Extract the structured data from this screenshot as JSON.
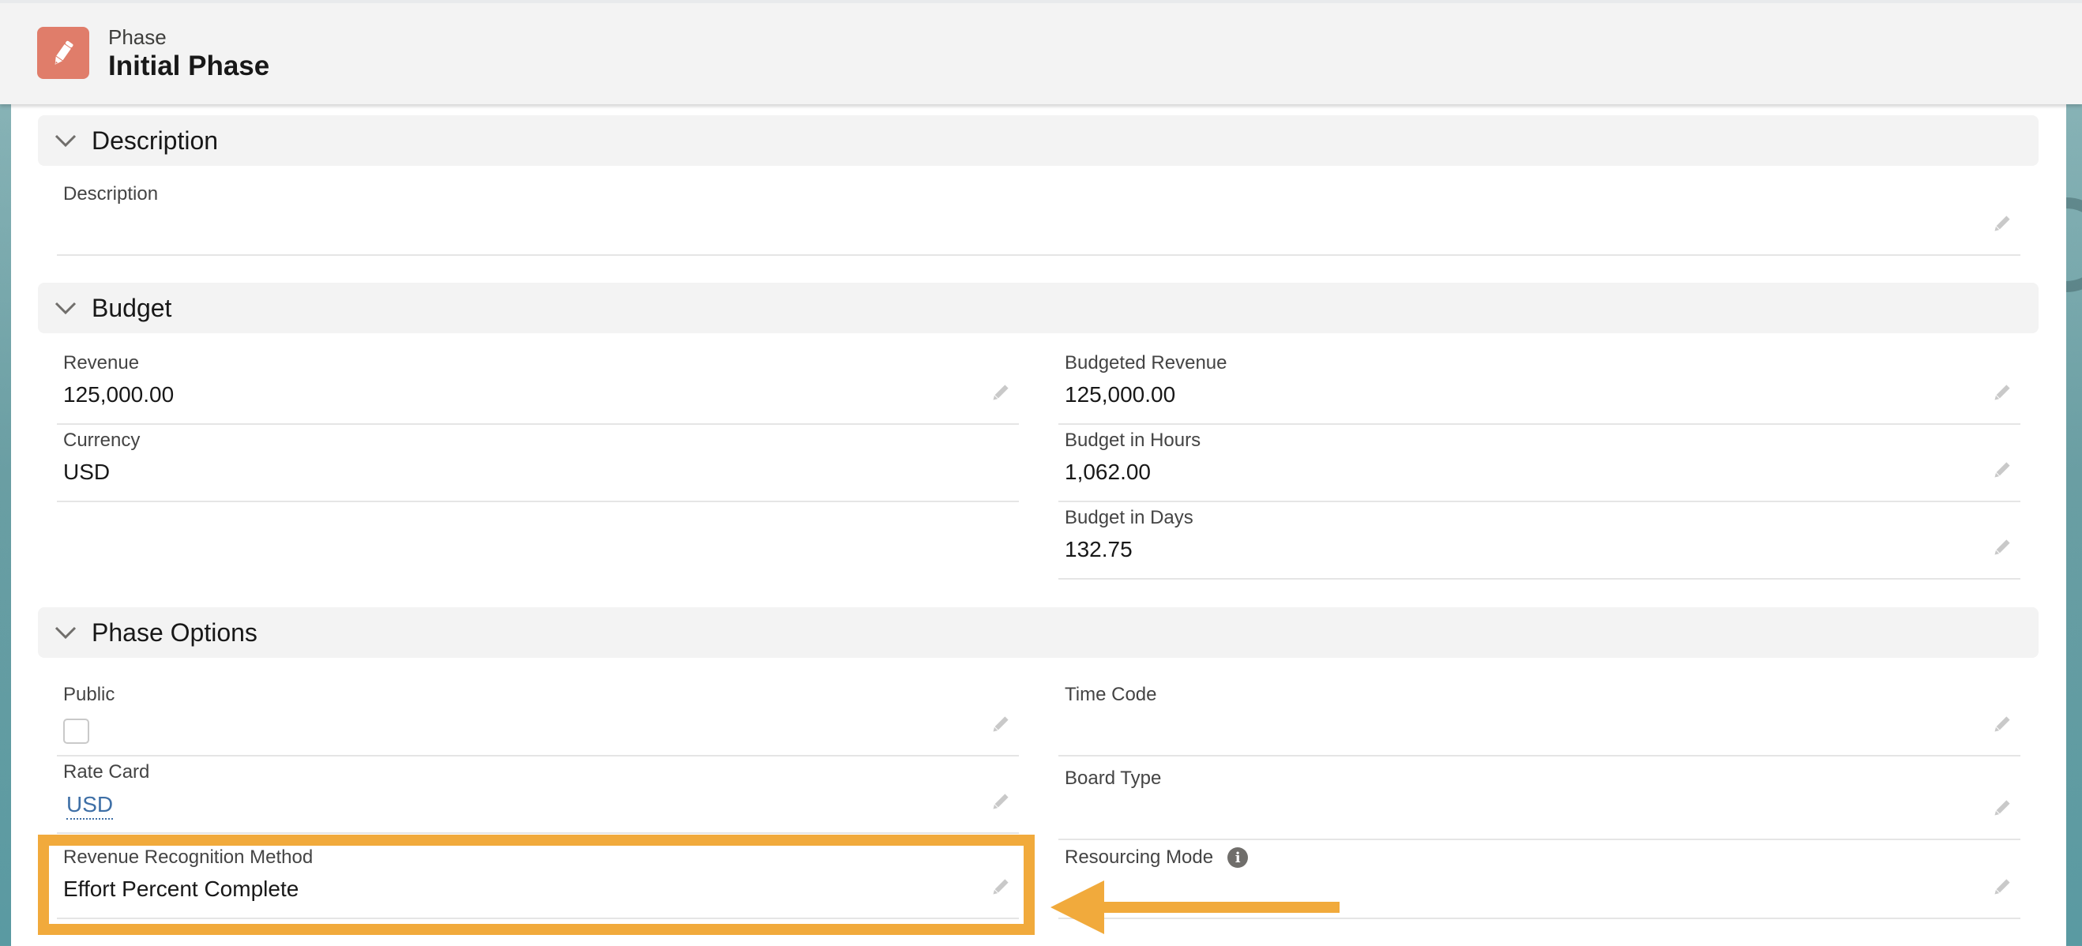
{
  "header": {
    "object_label": "Phase",
    "record_title": "Initial Phase",
    "icon": "pencil-icon",
    "icon_color": "#e07d6a"
  },
  "sections": {
    "description": {
      "title": "Description",
      "fields": {
        "description": {
          "label": "Description",
          "value": ""
        }
      }
    },
    "budget": {
      "title": "Budget",
      "fields": {
        "revenue": {
          "label": "Revenue",
          "value": "125,000.00"
        },
        "currency": {
          "label": "Currency",
          "value": "USD"
        },
        "budgeted_revenue": {
          "label": "Budgeted Revenue",
          "value": "125,000.00"
        },
        "budget_in_hours": {
          "label": "Budget in Hours",
          "value": "1,062.00"
        },
        "budget_in_days": {
          "label": "Budget in Days",
          "value": "132.75"
        }
      }
    },
    "phase_options": {
      "title": "Phase Options",
      "fields": {
        "public": {
          "label": "Public",
          "checked": false
        },
        "time_code": {
          "label": "Time Code",
          "value": ""
        },
        "rate_card": {
          "label": "Rate Card",
          "value": "USD"
        },
        "board_type": {
          "label": "Board Type",
          "value": ""
        },
        "revenue_recognition_method": {
          "label": "Revenue Recognition Method",
          "value": "Effort Percent Complete"
        },
        "resourcing_mode": {
          "label": "Resourcing Mode",
          "value": "",
          "info_icon": "i"
        }
      }
    }
  },
  "annotation": {
    "highlight_color": "#f1aa3c",
    "highlighted_field": "Revenue Recognition Method"
  }
}
